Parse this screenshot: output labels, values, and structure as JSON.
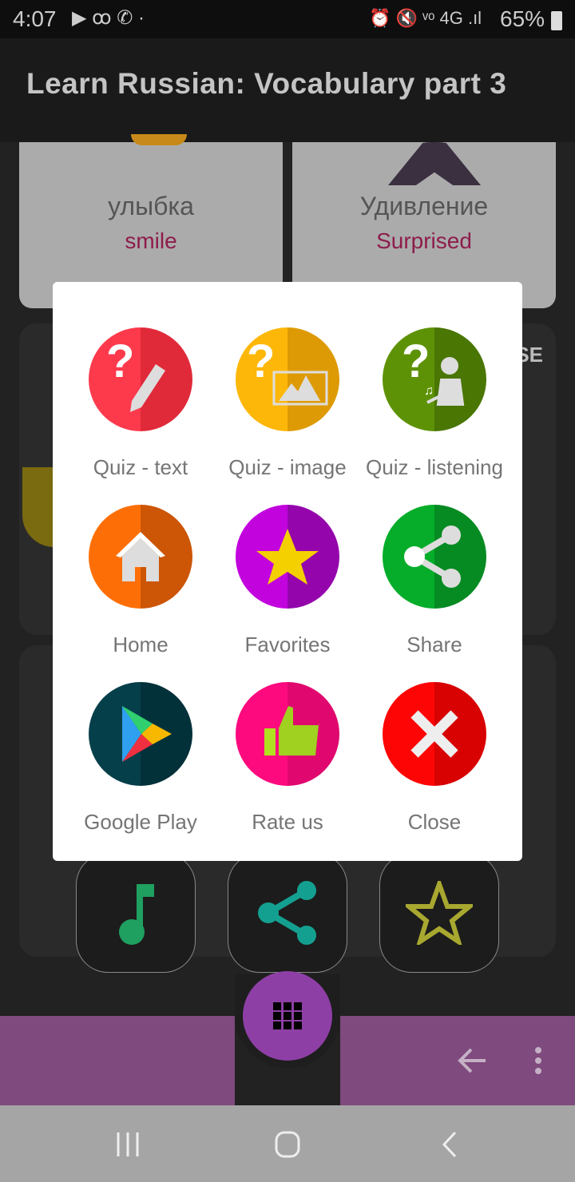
{
  "status_bar": {
    "time": "4:07",
    "battery": "65%",
    "icons": [
      "play-store-icon",
      "voicemail-icon",
      "whatsapp-icon",
      "alarm-icon",
      "mute-icon",
      "volte-icon",
      "4g-icon",
      "signal-icon",
      "battery-icon"
    ]
  },
  "app_bar": {
    "title": "Learn Russian: Vocabulary part 3"
  },
  "cards": [
    {
      "russian": "улыбка",
      "english": "smile"
    },
    {
      "russian": "Удивление",
      "english": "Surprised"
    }
  ],
  "background_partial_text": "SE",
  "dialog": {
    "items": [
      {
        "label": "Quiz - text",
        "icon": "quiz-text-icon",
        "color": "#fc3a4c",
        "dark": "#e02a3a"
      },
      {
        "label": "Quiz - image",
        "icon": "quiz-image-icon",
        "color": "#fdb709",
        "dark": "#de9a04"
      },
      {
        "label": "Quiz - listening",
        "icon": "quiz-listening-icon",
        "color": "#5e9206",
        "dark": "#4a7604"
      },
      {
        "label": "Home",
        "icon": "home-icon",
        "color": "#fd6f06",
        "dark": "#cc5506"
      },
      {
        "label": "Favorites",
        "icon": "star-icon",
        "color": "#c203de",
        "dark": "#9406ac"
      },
      {
        "label": "Share",
        "icon": "share-icon",
        "color": "#05ad2a",
        "dark": "#068a22"
      },
      {
        "label": "Google Play",
        "icon": "google-play-icon",
        "color": "#053f4a",
        "dark": "#03313a"
      },
      {
        "label": "Rate us",
        "icon": "thumbs-up-icon",
        "color": "#fd0a7e",
        "dark": "#e0086e"
      },
      {
        "label": "Close",
        "icon": "close-icon",
        "color": "#fd0505",
        "dark": "#d80202"
      }
    ]
  },
  "action_buttons": [
    {
      "icon": "music-note-icon",
      "color": "#1fa060"
    },
    {
      "icon": "share-icon",
      "color": "#14a090"
    },
    {
      "icon": "star-outline-icon",
      "color": "#a8a830"
    }
  ],
  "bottom_bar": {
    "color": "#7f4a7d",
    "fab_color": "#8e3fa6",
    "fab_icon": "grid-icon",
    "icons": [
      "back-arrow-icon",
      "more-vert-icon"
    ]
  },
  "nav_bar": {
    "icons": [
      "recents-icon",
      "home-icon",
      "back-icon"
    ]
  }
}
